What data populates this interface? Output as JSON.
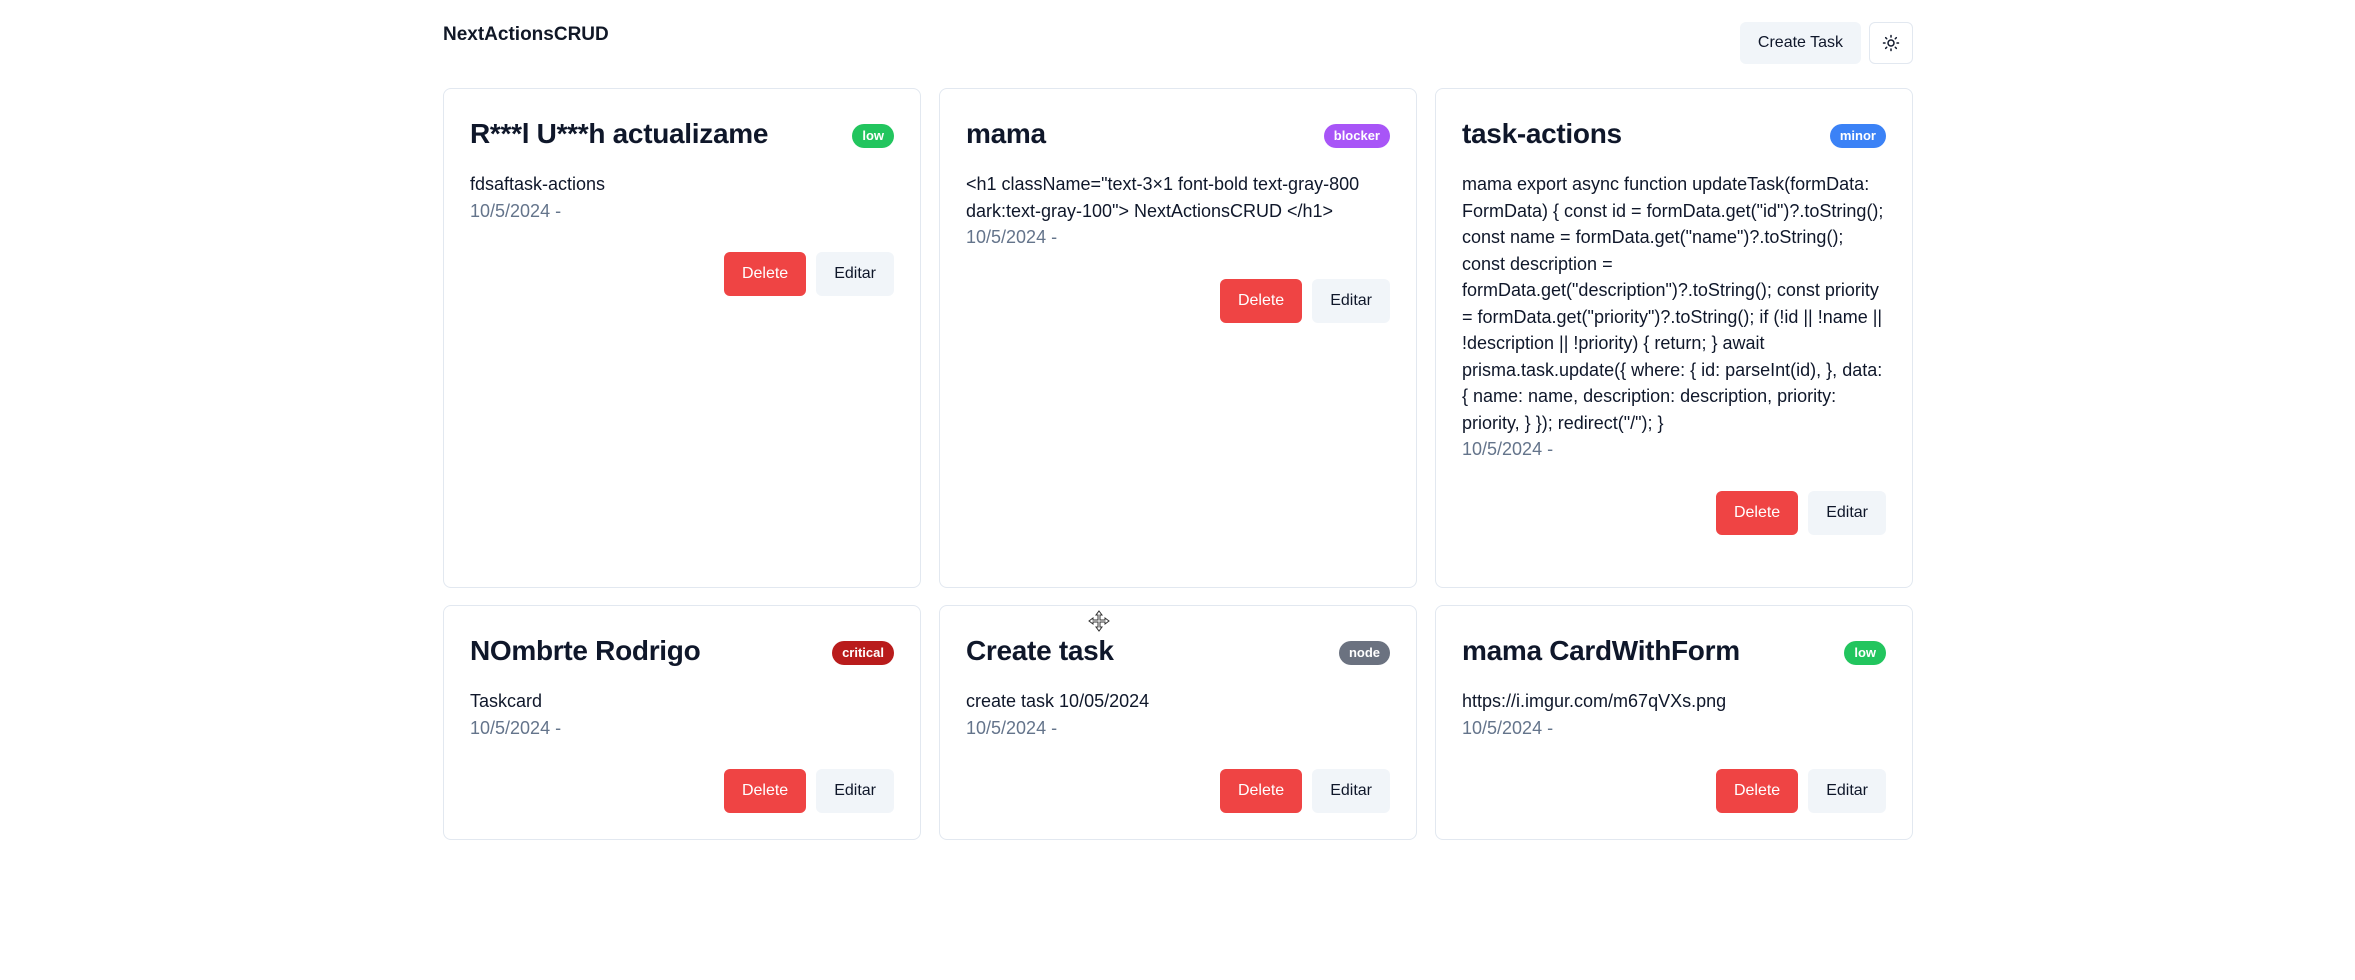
{
  "app": {
    "title": "NextActionsCRUD",
    "create_label": "Create Task",
    "theme_icon": "sun-icon"
  },
  "colors": {
    "low": "#22c55e",
    "blocker": "#a855f7",
    "minor": "#3b82f6",
    "critical": "#b91c1c",
    "node": "#6b7280",
    "delete": "#ef4444"
  },
  "tasks": [
    {
      "title": "R***l U***h actualizame",
      "priority": "low",
      "description": "fdsaftask-actions",
      "date": "10/5/2024 -",
      "delete_label": "Delete",
      "edit_label": "Editar"
    },
    {
      "title": "mama",
      "priority": "blocker",
      "description": "<h1 className=\"text-3×1 font-bold text-gray-800 dark:text-gray-100\"> NextActionsCRUD </h1>",
      "date": "10/5/2024 -",
      "delete_label": "Delete",
      "edit_label": "Editar"
    },
    {
      "title": "task-actions",
      "priority": "minor",
      "description": "mama export async function updateTask(formData: FormData) { const id = formData.get(\"id\")?.toString(); const name = formData.get(\"name\")?.toString(); const description = formData.get(\"description\")?.toString(); const priority = formData.get(\"priority\")?.toString(); if (!id || !name || !description || !priority) { return; } await prisma.task.update({ where: { id: parseInt(id), }, data: { name: name, description: description, priority: priority, } }); redirect(\"/\"); }",
      "date": "10/5/2024 -",
      "delete_label": "Delete",
      "edit_label": "Editar"
    },
    {
      "title": "NOmbrte Rodrigo",
      "priority": "critical",
      "description": "Taskcard",
      "date": "10/5/2024 -",
      "delete_label": "Delete",
      "edit_label": "Editar"
    },
    {
      "title": "Create task",
      "priority": "node",
      "description": "create task 10/05/2024",
      "date": "10/5/2024 -",
      "delete_label": "Delete",
      "edit_label": "Editar"
    },
    {
      "title": "mama CardWithForm",
      "priority": "low",
      "description": "https://i.imgur.com/m67qVXs.png",
      "date": "10/5/2024 -",
      "delete_label": "Delete",
      "edit_label": "Editar"
    }
  ]
}
